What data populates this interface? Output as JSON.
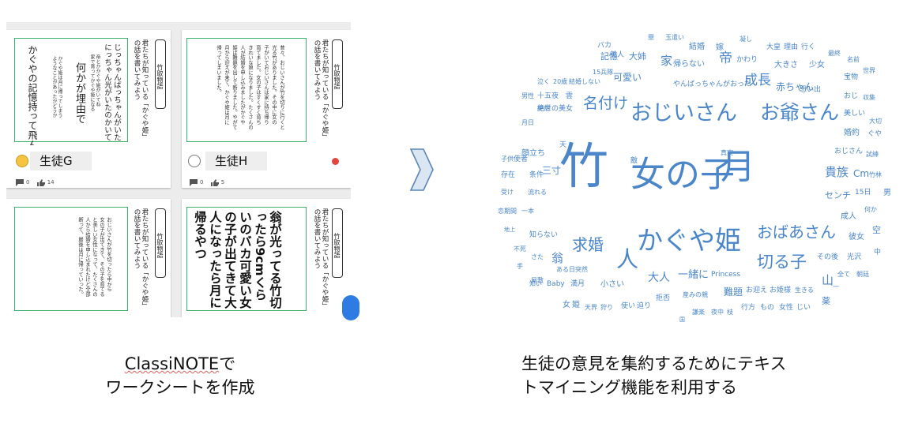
{
  "colors": {
    "accent_blue": "#4a86c9",
    "sheet_border": "#38b36b",
    "arrow_fill": "#dbe6f3",
    "arrow_stroke": "#5b86b8",
    "fab": "#2f7be4"
  },
  "cards": [
    {
      "tag": "竹取物語",
      "question": "君たちが知っている「かぐや姫」\nの話を書いてみよう",
      "answer_small": "じっちゃんばっちゃんがいた\nにっちゃん光がいたのかいて",
      "answer_small_2": "帝とかかぐや姫がいてね\n家で育ってかぐや姫になる",
      "answer_main": "何かが埋由で",
      "answer_tail": "かぐや姫は月に帰ってしまう\nようなことがあったかどうか",
      "answer_bottom": "かぐやの記憶持って飛んだ",
      "student": "生徒G",
      "avatar_icon": "emoji-face-icon",
      "comments": "0",
      "likes": "14"
    },
    {
      "tag": "竹取物語",
      "question": "君たちが知っている「かぐや姫」\nの話を書いてみよう",
      "answer_small": "昔々、おじいさんが竹を切りに行くと\n光る竹がありました。その中に女の\n子がいておじいさんは家に持ち帰り\n育てました。女の子はすくすく育ち\nきれいな娘になりました。たくさんの\n人が結婚を申し込みましたがかぐや\n姫は難題を出して断りました。やがて\n月から迎えが来て、かぐや姫は月に\n帰ってしまいました。",
      "student": "生徒H",
      "avatar_icon": "person-avatar-icon",
      "comments": "0",
      "likes": "5"
    },
    {
      "tag": "竹取物語",
      "question": "君たちが知っている「かぐや姫」\nの話を書いてみよう",
      "answer_small": "おじいさんが竹を切ったら中から\n女の子が出てきて、その子を育てる\nと美しい女性になって、たくさんの\n人から結婚を申し込まれたけど全部\n断って、最後は月に帰っていった。"
    },
    {
      "tag": "竹取物語",
      "question": "君たちが知っている「かぐや姫」\nの話を書いてみよう",
      "answer_main": "翁が光ってる竹切\nったら9cmくら\nいのバカ可愛い女\nの子が出てきて大\n人になったら月に\n帰るやつ"
    }
  ],
  "captions": {
    "left_line1_brand": "ClassiNOTE",
    "left_line1_rest": "で",
    "left_line2": "ワークシートを作成",
    "right_line1": "生徒の意見を集約するためにテキス",
    "right_line2": "トマイニング機能を利用する"
  },
  "word_cloud": {
    "words": [
      {
        "text": "竹",
        "size": 62
      },
      {
        "text": "女の子",
        "size": 44
      },
      {
        "text": "月",
        "size": 44
      },
      {
        "text": "かぐや姫",
        "size": 33
      },
      {
        "text": "おじいさん",
        "size": 27
      },
      {
        "text": "お爺さん",
        "size": 25
      },
      {
        "text": "求婚",
        "size": 20
      },
      {
        "text": "人",
        "size": 28
      },
      {
        "text": "おばあさん",
        "size": 20
      },
      {
        "text": "切る子",
        "size": 21
      },
      {
        "text": "名付け",
        "size": 19
      },
      {
        "text": "成長",
        "size": 17
      },
      {
        "text": "帝",
        "size": 17
      },
      {
        "text": "家",
        "size": 15
      },
      {
        "text": "貴族",
        "size": 15
      },
      {
        "text": "Cm",
        "size": 12
      },
      {
        "text": "大人",
        "size": 14
      },
      {
        "text": "一緒に",
        "size": 13
      },
      {
        "text": "翁",
        "size": 15
      },
      {
        "text": "山",
        "size": 15
      },
      {
        "text": "三寸",
        "size": 12
      },
      {
        "text": "顔立ち",
        "size": 10
      },
      {
        "text": "難題",
        "size": 12
      },
      {
        "text": "可愛い",
        "size": 12
      },
      {
        "text": "赤ちゃん",
        "size": 12
      },
      {
        "text": "記憶",
        "size": 11
      },
      {
        "text": "大姉",
        "size": 11
      },
      {
        "text": "結婚",
        "size": 10
      },
      {
        "text": "嫁",
        "size": 10
      },
      {
        "text": "帰らない",
        "size": 10
      },
      {
        "text": "かわり",
        "size": 9
      },
      {
        "text": "やんばっちゃんがおった",
        "size": 9
      },
      {
        "text": "大きさ",
        "size": 10
      },
      {
        "text": "少女",
        "size": 10
      },
      {
        "text": "思い出",
        "size": 9
      },
      {
        "text": "宝物",
        "size": 9
      },
      {
        "text": "おじ",
        "size": 9
      },
      {
        "text": "収集",
        "size": 8
      },
      {
        "text": "美しい",
        "size": 9
      },
      {
        "text": "大切",
        "size": 8
      },
      {
        "text": "婚約",
        "size": 10
      },
      {
        "text": "ぐや",
        "size": 9
      },
      {
        "text": "おじさん",
        "size": 9
      },
      {
        "text": "試練",
        "size": 8
      },
      {
        "text": "竹林",
        "size": 8
      },
      {
        "text": "センチ",
        "size": 11
      },
      {
        "text": "15日",
        "size": 9
      },
      {
        "text": "男",
        "size": 10
      },
      {
        "text": "成人",
        "size": 10
      },
      {
        "text": "何か",
        "size": 8
      },
      {
        "text": "彼女",
        "size": 10
      },
      {
        "text": "空",
        "size": 11
      },
      {
        "text": "その後",
        "size": 9
      },
      {
        "text": "光沢",
        "size": 9
      },
      {
        "text": "中",
        "size": 9
      },
      {
        "text": "全て",
        "size": 8
      },
      {
        "text": "朝廷",
        "size": 8
      },
      {
        "text": "一",
        "size": 8
      },
      {
        "text": "薬",
        "size": 11
      },
      {
        "text": "Princess",
        "size": 9
      },
      {
        "text": "お迎え",
        "size": 9
      },
      {
        "text": "お姫様",
        "size": 9
      },
      {
        "text": "生きる",
        "size": 8
      },
      {
        "text": "行方",
        "size": 9
      },
      {
        "text": "もの",
        "size": 9
      },
      {
        "text": "女性",
        "size": 9
      },
      {
        "text": "じい",
        "size": 9
      },
      {
        "text": "産みの親",
        "size": 8
      },
      {
        "text": "拒否",
        "size": 9
      },
      {
        "text": "謙楽",
        "size": 8
      },
      {
        "text": "夜中",
        "size": 8
      },
      {
        "text": "枝",
        "size": 8
      },
      {
        "text": "国",
        "size": 7
      },
      {
        "text": "使い",
        "size": 9
      },
      {
        "text": "迫り",
        "size": 9
      },
      {
        "text": "天界",
        "size": 8
      },
      {
        "text": "狩り",
        "size": 8
      },
      {
        "text": "女",
        "size": 10
      },
      {
        "text": "姫",
        "size": 10
      },
      {
        "text": "知い",
        "size": 8
      },
      {
        "text": "Baby",
        "size": 9
      },
      {
        "text": "満月",
        "size": 9
      },
      {
        "text": "小さい",
        "size": 10
      },
      {
        "text": "ある日",
        "size": 8
      },
      {
        "text": "突然",
        "size": 8
      },
      {
        "text": "屋敷",
        "size": 8
      },
      {
        "text": "さた",
        "size": 8
      },
      {
        "text": "手",
        "size": 8
      },
      {
        "text": "不死",
        "size": 8
      },
      {
        "text": "知らない",
        "size": 9
      },
      {
        "text": "地上",
        "size": 7
      },
      {
        "text": "恋期間",
        "size": 8
      },
      {
        "text": "一本",
        "size": 8
      },
      {
        "text": "受け",
        "size": 8
      },
      {
        "text": "流れる",
        "size": 8
      },
      {
        "text": "存在",
        "size": 9
      },
      {
        "text": "条件",
        "size": 9
      },
      {
        "text": "子供",
        "size": 8
      },
      {
        "text": "使者",
        "size": 9
      },
      {
        "text": "突然",
        "size": 8
      },
      {
        "text": "月日",
        "size": 8
      },
      {
        "text": "絶世の美女",
        "size": 9
      },
      {
        "text": "男性",
        "size": 8
      },
      {
        "text": "十五夜",
        "size": 9
      },
      {
        "text": "雲",
        "size": 9
      },
      {
        "text": "泣く",
        "size": 8
      },
      {
        "text": "20歳",
        "size": 8
      },
      {
        "text": "結婚しない",
        "size": 8
      },
      {
        "text": "15兵隊",
        "size": 8
      },
      {
        "text": "バカ",
        "size": 9
      },
      {
        "text": "美人",
        "size": 9
      },
      {
        "text": "罪",
        "size": 8
      },
      {
        "text": "玉遣い",
        "size": 8
      },
      {
        "text": "凝し",
        "size": 8
      },
      {
        "text": "大皇",
        "size": 9
      },
      {
        "text": "理由",
        "size": 9
      },
      {
        "text": "行く",
        "size": 9
      },
      {
        "text": "最終",
        "size": 8
      },
      {
        "text": "名前",
        "size": 8
      },
      {
        "text": "世界",
        "size": 8
      },
      {
        "text": "天",
        "size": 9
      },
      {
        "text": "敵",
        "size": 9
      },
      {
        "text": "真実",
        "size": 8
      }
    ]
  }
}
